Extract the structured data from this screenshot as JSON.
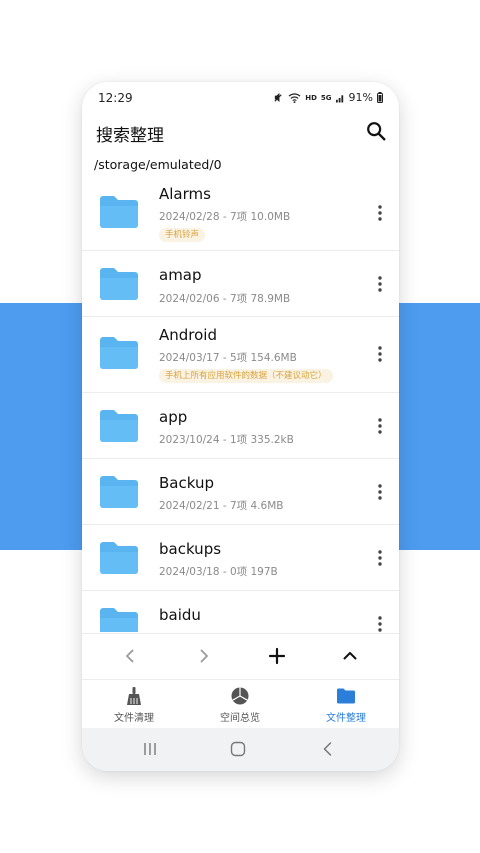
{
  "status": {
    "time": "12:29",
    "network": "HD",
    "signal": "5G",
    "battery": "91%"
  },
  "header": {
    "title": "搜索整理"
  },
  "path": "/storage/emulated/0",
  "files": [
    {
      "name": "Alarms",
      "meta": "2024/02/28 - 7项 10.0MB",
      "tag": "手机铃声"
    },
    {
      "name": "amap",
      "meta": "2024/02/06 - 7项 78.9MB",
      "tag": ""
    },
    {
      "name": "Android",
      "meta": "2024/03/17 - 5项 154.6MB",
      "tag": "手机上所有应用软件的数据（不建议动它）"
    },
    {
      "name": "app",
      "meta": "2023/10/24 - 1项 335.2kB",
      "tag": ""
    },
    {
      "name": "Backup",
      "meta": "2024/02/21 - 7项 4.6MB",
      "tag": ""
    },
    {
      "name": "backups",
      "meta": "2024/03/18 - 0项 197B",
      "tag": ""
    },
    {
      "name": "baidu",
      "meta": "",
      "tag": ""
    }
  ],
  "tabs": [
    {
      "label": "文件清理",
      "icon": "broom-icon"
    },
    {
      "label": "空间总览",
      "icon": "pie-chart-icon"
    },
    {
      "label": "文件整理",
      "icon": "folder-icon"
    }
  ],
  "colors": {
    "accent": "#2b7fd9",
    "folder": "#5ab4f0",
    "band": "#4d9cf0",
    "tag_text": "#d9a23a",
    "tag_bg": "#faf3e3"
  }
}
